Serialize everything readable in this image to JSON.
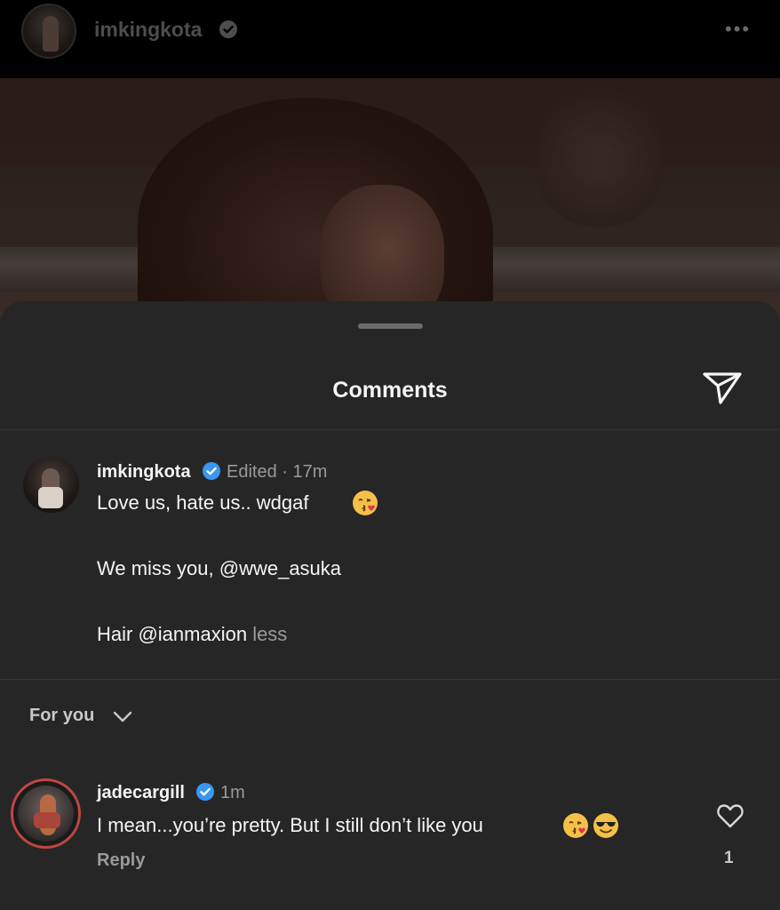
{
  "header": {
    "username": "imkingkota",
    "verified_icon": "verified-badge-icon",
    "more_icon": "more-horizontal-icon",
    "more_glyph": "•••"
  },
  "sheet": {
    "title": "Comments",
    "share_icon": "send-paper-plane-icon"
  },
  "caption": {
    "username": "imkingkota",
    "meta": "Edited · 17m",
    "line1": "Love us, hate us.. wdgaf",
    "line1_emoji": "kissing-heart-emoji",
    "line2": "We miss you, @wwe_asuka",
    "line3": "Hair @ianmaxion",
    "less_label": "less"
  },
  "filter": {
    "label": "For you",
    "icon": "chevron-down-icon"
  },
  "comments": [
    {
      "username": "jadecargill",
      "time": "1m",
      "text": "I mean...you’re pretty. But I still don’t like you",
      "emojis": [
        "kissing-heart-emoji",
        "sunglasses-emoji"
      ],
      "reply_label": "Reply",
      "like_count": "1",
      "like_icon": "heart-outline-icon"
    }
  ],
  "colors": {
    "background": "#262626",
    "topbar": "#000000",
    "verified_blue": "#3897f0",
    "muted_text": "#9a9a9a",
    "primary_text": "#f5f5f5",
    "avatar_ring": "#c0473f"
  }
}
